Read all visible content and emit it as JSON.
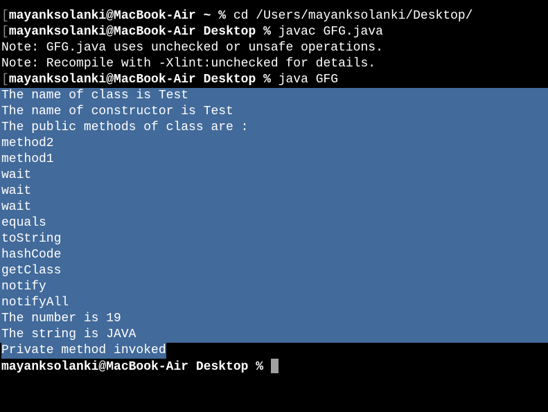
{
  "lines": [
    {
      "bracket": "[",
      "prompt": "mayanksolanki@MacBook-Air ~ % ",
      "cmd": "cd /Users/mayanksolanki/Desktop/"
    },
    {
      "bracket": "[",
      "prompt": "mayanksolanki@MacBook-Air Desktop % ",
      "cmd": "javac GFG.java"
    },
    {
      "text": "Note: GFG.java uses unchecked or unsafe operations."
    },
    {
      "text": "Note: Recompile with -Xlint:unchecked for details."
    },
    {
      "bracket": "[",
      "prompt": "mayanksolanki@MacBook-Air Desktop % ",
      "cmd": "java GFG"
    }
  ],
  "output": [
    "The name of class is Test",
    "The name of constructor is Test",
    "The public methods of class are : ",
    "method2",
    "method1",
    "wait",
    "wait",
    "wait",
    "equals",
    "toString",
    "hashCode",
    "getClass",
    "notify",
    "notifyAll",
    "The number is 19",
    "The string is JAVA"
  ],
  "last_output": "Private method invoked",
  "final_prompt": "mayanksolanki@MacBook-Air Desktop % "
}
